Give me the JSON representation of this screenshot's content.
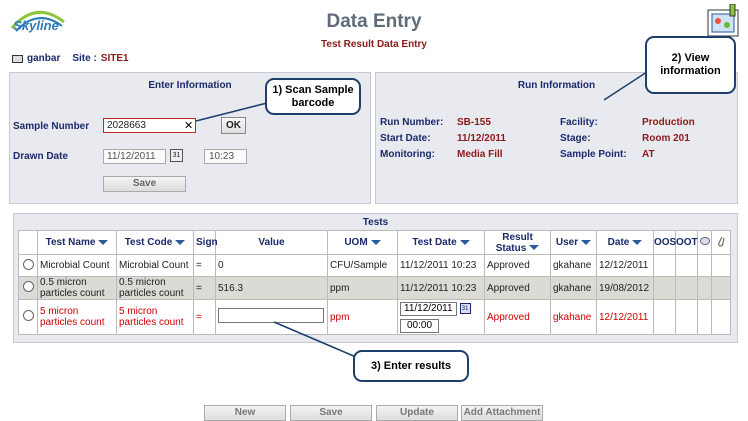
{
  "header": {
    "logo_text": "Skyline",
    "title": "Data Entry",
    "subtitle": "Test Result Data Entry",
    "user": "ganbar",
    "site_label": "Site :",
    "site_value": "SITE1"
  },
  "enter_info": {
    "title": "Enter Information",
    "sample_number_label": "Sample Number",
    "sample_number_value": "2028663",
    "clear_glyph": "✕",
    "ok_label": "OK",
    "drawn_date_label": "Drawn Date",
    "drawn_date_value": "11/12/2011",
    "drawn_time_value": "10:23",
    "save_label": "Save"
  },
  "run_info": {
    "title": "Run Information",
    "run_number_label": "Run Number:",
    "run_number_value": "SB-155",
    "start_date_label": "Start Date:",
    "start_date_value": "11/12/2011",
    "monitoring_label": "Monitoring:",
    "monitoring_value": "Media Fill",
    "facility_label": "Facility:",
    "facility_value": "Production",
    "stage_label": "Stage:",
    "stage_value": "Room 201",
    "sample_point_label": "Sample Point:",
    "sample_point_value": "AT"
  },
  "callouts": {
    "c1": "1) Scan Sample barcode",
    "c2": "2) View information",
    "c3": "3) Enter results"
  },
  "tests": {
    "title": "Tests",
    "columns": [
      "Test Name",
      "Test Code",
      "Sign",
      "Value",
      "UOM",
      "Test Date",
      "Result Status",
      "User",
      "Date",
      "OOS",
      "OOT"
    ],
    "rows": [
      {
        "name": "Microbial Count",
        "code": "Microbial Count",
        "sign": "=",
        "value": "0",
        "uom": "CFU/Sample",
        "test_date": "11/12/2011 10:23",
        "status": "Approved",
        "user": "gkahane",
        "date": "12/12/2011"
      },
      {
        "name": "0.5 micron particles count",
        "code": "0.5 micron particles count",
        "sign": "=",
        "value": "516.3",
        "uom": "ppm",
        "test_date": "11/12/2011 10:23",
        "status": "Approved",
        "user": "gkahane",
        "date": "19/08/2012"
      },
      {
        "name": "5 micron particles count",
        "code": "5 micron particles count",
        "sign": "=",
        "value": "",
        "uom": "ppm",
        "test_date": "11/12/2011",
        "test_time": "00:00",
        "status": "Approved",
        "user": "gkahane",
        "date": "12/12/2011"
      }
    ]
  },
  "buttons": {
    "new": "New",
    "save": "Save",
    "update": "Update",
    "add_attachment": "Add Attachment"
  },
  "colors": {
    "title": "#5f6b78",
    "label_blue": "#1a2a6a",
    "value_red": "#8b1a1a",
    "panel_bg": "#e9eaf0",
    "callout_border": "#1e3f6b"
  }
}
